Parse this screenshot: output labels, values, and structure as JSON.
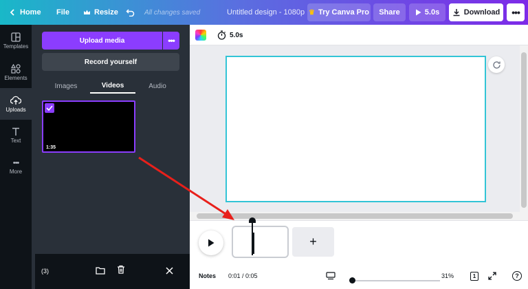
{
  "topbar": {
    "home": "Home",
    "file": "File",
    "resize": "Resize",
    "save_status": "All changes saved",
    "title": "Untitled design - 1080p",
    "try_pro": "Try Canva Pro",
    "share": "Share",
    "play_duration": "5.0s",
    "download": "Download",
    "more_icon": "ellipsis-icon"
  },
  "rail": {
    "items": [
      {
        "label": "Templates",
        "icon": "templates-icon"
      },
      {
        "label": "Elements",
        "icon": "elements-icon"
      },
      {
        "label": "Uploads",
        "icon": "upload-cloud-icon",
        "active": true
      },
      {
        "label": "Text",
        "icon": "text-icon"
      },
      {
        "label": "More",
        "icon": "more-dots-icon"
      }
    ]
  },
  "panel": {
    "upload_button": "Upload media",
    "record_button": "Record yourself",
    "tabs": [
      {
        "label": "Images"
      },
      {
        "label": "Videos",
        "active": true
      },
      {
        "label": "Audio"
      }
    ],
    "video": {
      "duration": "1:35",
      "selected": true
    },
    "selection": {
      "count": "(3)"
    }
  },
  "toolbar": {
    "duration": "5.0s"
  },
  "timeline": {
    "add_icon": "+"
  },
  "footer": {
    "notes": "Notes",
    "time": "0:01 / 0:05",
    "zoom": "31%",
    "page_num": "1",
    "help": "?"
  },
  "colors": {
    "accent": "#8b3dff",
    "canvas_border": "#32c4d6",
    "annotation_arrow": "#e8201b"
  }
}
